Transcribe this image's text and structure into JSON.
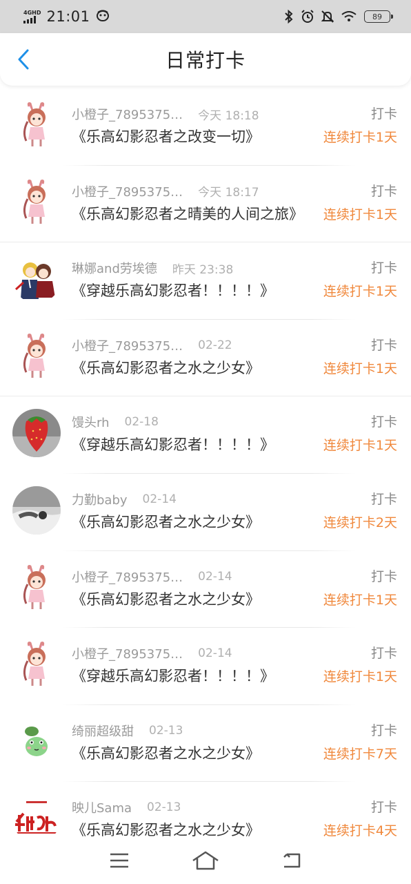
{
  "status_bar": {
    "network": "4GHD",
    "time": "21:01",
    "battery": "89",
    "icons": [
      "signal-icon",
      "messenger-icon",
      "bluetooth-icon",
      "alarm-icon",
      "mute-icon",
      "wifi-icon",
      "battery-icon"
    ]
  },
  "header": {
    "title": "日常打卡",
    "back_icon": "chevron-left-icon"
  },
  "checkins": [
    {
      "user": "小橙子_7895375…",
      "time": "今天 18:18",
      "work": "《乐高幻影忍者之改变一切》",
      "tag": "打卡",
      "streak": "连续打卡1天",
      "avatar": "anime-girl"
    },
    {
      "user": "小橙子_7895375…",
      "time": "今天 18:17",
      "work": "《乐高幻影忍者之晴美的人间之旅》",
      "tag": "打卡",
      "streak": "连续打卡1天",
      "avatar": "anime-girl"
    },
    {
      "user": "琳娜and劳埃德",
      "time": "昨天 23:38",
      "work": "《穿越乐高幻影忍者！！！！》",
      "tag": "打卡",
      "streak": "连续打卡1天",
      "avatar": "anime-pair"
    },
    {
      "user": "小橙子_7895375…",
      "time": "02-22",
      "work": "《乐高幻影忍者之水之少女》",
      "tag": "打卡",
      "streak": "连续打卡1天",
      "avatar": "anime-girl"
    },
    {
      "user": "馒头rh",
      "time": "02-18",
      "work": "《穿越乐高幻影忍者！！！！》",
      "tag": "打卡",
      "streak": "连续打卡1天",
      "avatar": "strawberry"
    },
    {
      "user": "力勤baby",
      "time": "02-14",
      "work": "《乐高幻影忍者之水之少女》",
      "tag": "打卡",
      "streak": "连续打卡2天",
      "avatar": "grey-photo"
    },
    {
      "user": "小橙子_7895375…",
      "time": "02-14",
      "work": "《乐高幻影忍者之水之少女》",
      "tag": "打卡",
      "streak": "连续打卡1天",
      "avatar": "anime-girl"
    },
    {
      "user": "小橙子_7895375…",
      "time": "02-14",
      "work": "《穿越乐高幻影忍者！！！！》",
      "tag": "打卡",
      "streak": "连续打卡1天",
      "avatar": "anime-girl"
    },
    {
      "user": "绮丽超级甜",
      "time": "02-13",
      "work": "《乐高幻影忍者之水之少女》",
      "tag": "打卡",
      "streak": "连续打卡7天",
      "avatar": "frog"
    },
    {
      "user": "映儿Sama",
      "time": "02-13",
      "work": "《乐高幻影忍者之水之少女》",
      "tag": "打卡",
      "streak": "连续打卡4天",
      "avatar": "red-text-logo"
    }
  ],
  "nav_bar": {
    "icons": [
      "menu-icon",
      "home-icon",
      "back-icon"
    ]
  },
  "colors": {
    "accent_blue": "#1e90e8",
    "streak_orange": "#f0883c",
    "status_bar_bg": "#d9d9d9"
  }
}
